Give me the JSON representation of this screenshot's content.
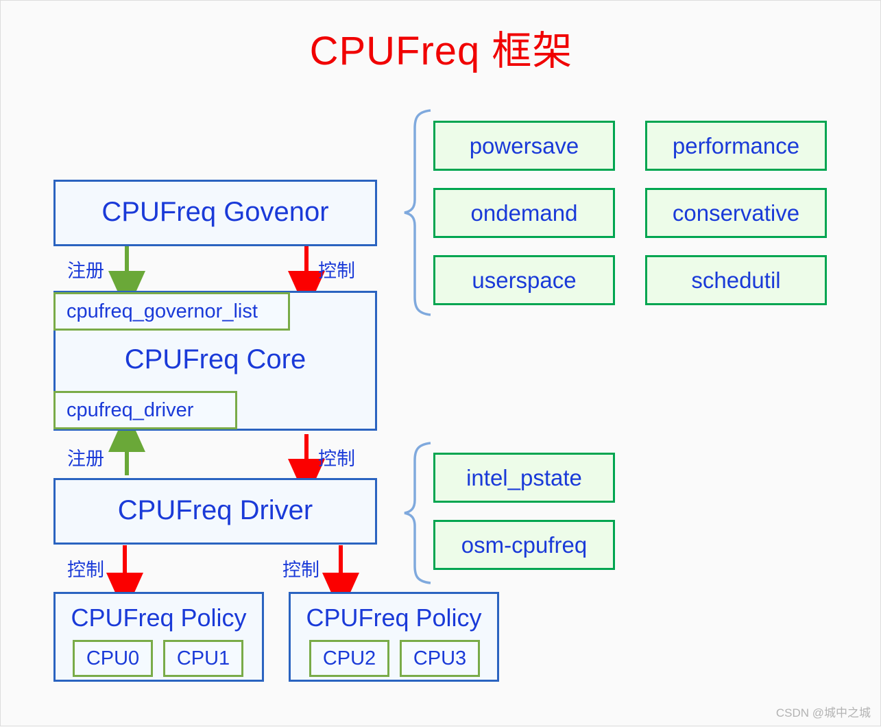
{
  "title": "CPUFreq 框架",
  "colors": {
    "title_red": "#f00000",
    "box_blue_border": "#2a63c0",
    "box_blue_fill": "#f4f9fe",
    "text_blue": "#1a3ad8",
    "green_border": "#00a550",
    "green_fill": "#edfce9",
    "olive_border": "#79ab48",
    "arrow_red": "#fb0000",
    "arrow_green": "#6aa838",
    "brace_blue": "#7fa9dd",
    "background": "#fafafa"
  },
  "boxes": {
    "governor": "CPUFreq Govenor",
    "core": "CPUFreq Core",
    "core_top_slot": "cpufreq_governor_list",
    "core_bottom_slot": "cpufreq_driver",
    "driver": "CPUFreq Driver",
    "policy_left": "CPUFreq Policy",
    "policy_right": "CPUFreq Policy"
  },
  "governors": [
    "powersave",
    "performance",
    "ondemand",
    "conservative",
    "userspace",
    "schedutil"
  ],
  "drivers": [
    "intel_pstate",
    "osm-cpufreq"
  ],
  "cpus_left": [
    "CPU0",
    "CPU1"
  ],
  "cpus_right": [
    "CPU2",
    "CPU3"
  ],
  "arrow_labels": {
    "governor_register": "注册",
    "governor_control": "控制",
    "driver_register": "注册",
    "driver_control": "控制",
    "policy_left_control": "控制",
    "policy_right_control": "控制"
  },
  "watermark": "CSDN @城中之城"
}
